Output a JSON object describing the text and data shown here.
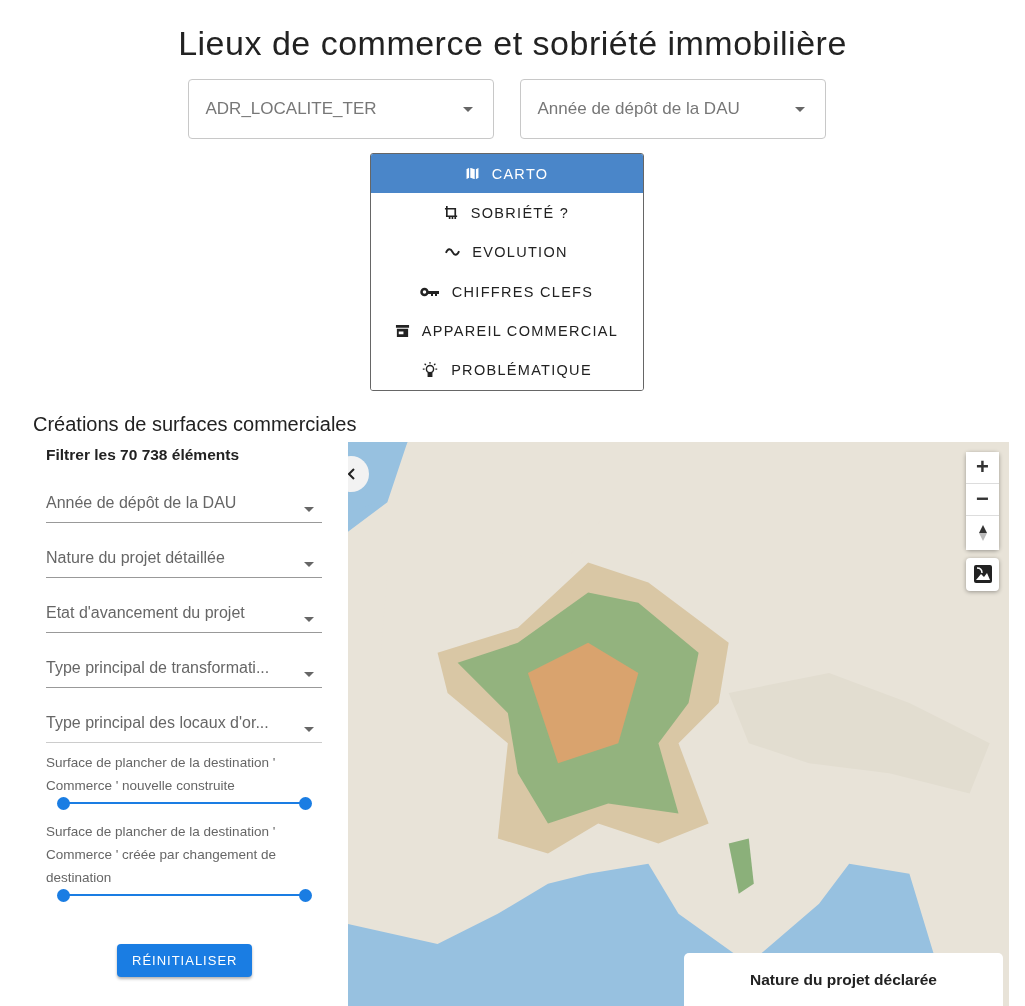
{
  "title": "Lieux de commerce et sobriété immobilière",
  "top_selects": [
    {
      "placeholder": "ADR_LOCALITE_TER"
    },
    {
      "placeholder": "Année de dépôt de la DAU"
    }
  ],
  "nav_menu": [
    {
      "label": "CARTO",
      "selected": true
    },
    {
      "label": "SOBRIÉTÉ ?",
      "selected": false
    },
    {
      "label": "EVOLUTION",
      "selected": false
    },
    {
      "label": "CHIFFRES CLEFS",
      "selected": false
    },
    {
      "label": "APPAREIL COMMERCIAL",
      "selected": false
    },
    {
      "label": "PROBLÉMATIQUE",
      "selected": false
    }
  ],
  "section_title": "Créations de surfaces commerciales",
  "filter_panel": {
    "heading": "Filtrer les 70 738 éléments",
    "selects": [
      {
        "placeholder": "Année de dépôt de la DAU"
      },
      {
        "placeholder": "Nature du projet détaillée"
      },
      {
        "placeholder": "Etat d'avancement du projet"
      },
      {
        "placeholder": "Type principal de transformati..."
      },
      {
        "placeholder": "Type principal des locaux d'or..."
      }
    ],
    "sliders": [
      {
        "label": "Surface de plancher de la destination ' Commerce ' nouvelle construite",
        "level": 1
      },
      {
        "label": "Surface de plancher de la destination ' Commerce ' créée par changement de destination",
        "level": 1
      }
    ],
    "reset_button": "RÉINITIALISER"
  },
  "map": {
    "kind": "picture",
    "zoom_in": "+",
    "zoom_out": "−",
    "legend_title": "Nature du projet déclarée"
  }
}
